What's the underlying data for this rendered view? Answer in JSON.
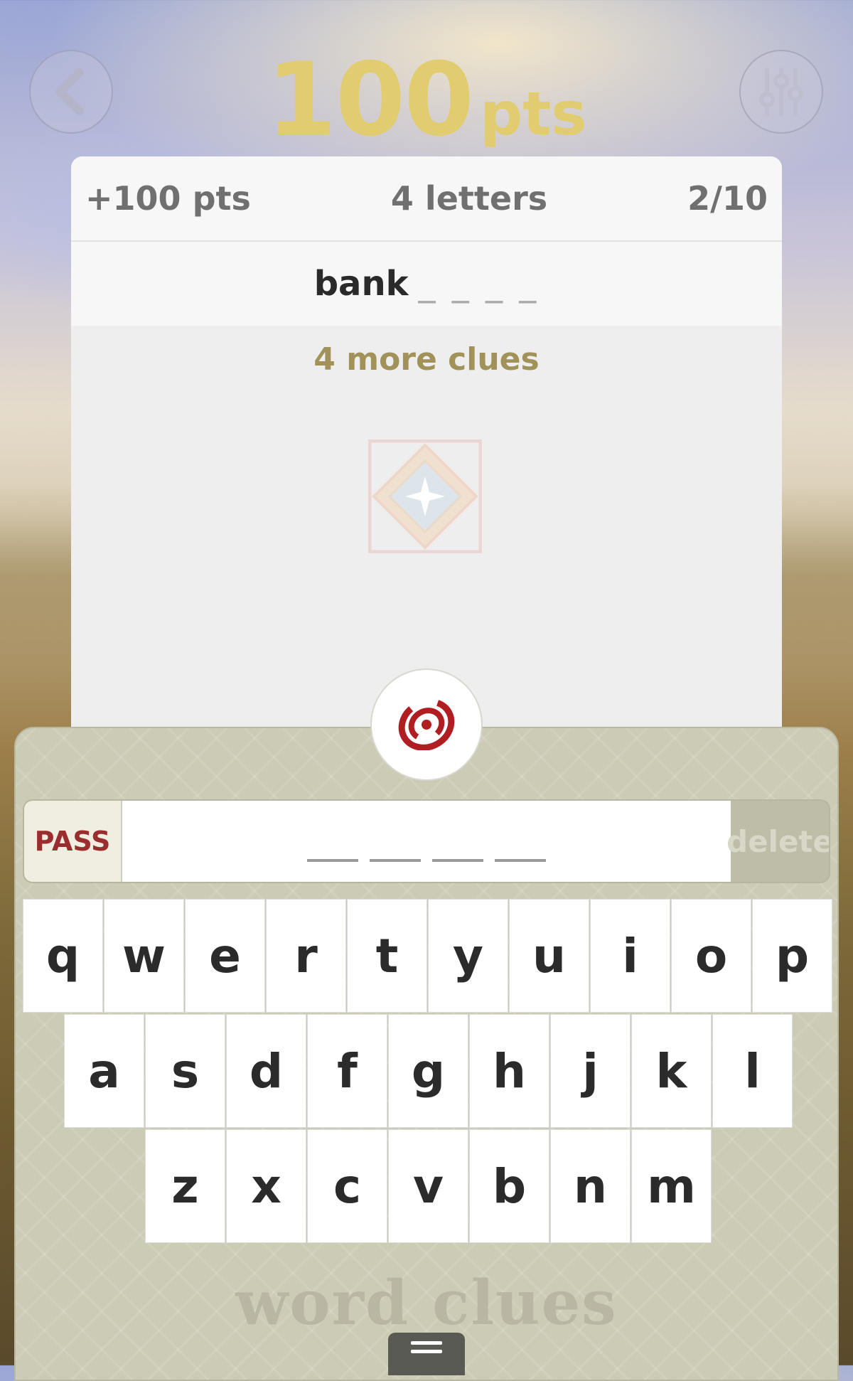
{
  "header": {
    "score_value": "100",
    "score_unit": "pts",
    "back_icon": "chevron-left-icon",
    "settings_icon": "sliders-icon"
  },
  "clue_card": {
    "points": "+100 pts",
    "letters": "4 letters",
    "progress": "2/10",
    "clue_word": "bank",
    "clue_blanks": "_ _ _ _",
    "more_clues": "4 more clues"
  },
  "answer": {
    "pass_label": "PASS",
    "delete_label": "delete",
    "slots": 4
  },
  "keyboard": {
    "row1": [
      "q",
      "w",
      "e",
      "r",
      "t",
      "y",
      "u",
      "i",
      "o",
      "p"
    ],
    "row2": [
      "a",
      "s",
      "d",
      "f",
      "g",
      "h",
      "j",
      "k",
      "l"
    ],
    "row3": [
      "z",
      "x",
      "c",
      "v",
      "b",
      "n",
      "m"
    ]
  },
  "footer": {
    "brand": "word clues",
    "menu_icon": "menu-icon"
  },
  "colors": {
    "score_gold": "#e2cc70",
    "pass_red": "#9a2e2e",
    "more_clues_olive": "#a09258",
    "spinner_red": "#b01e22"
  }
}
